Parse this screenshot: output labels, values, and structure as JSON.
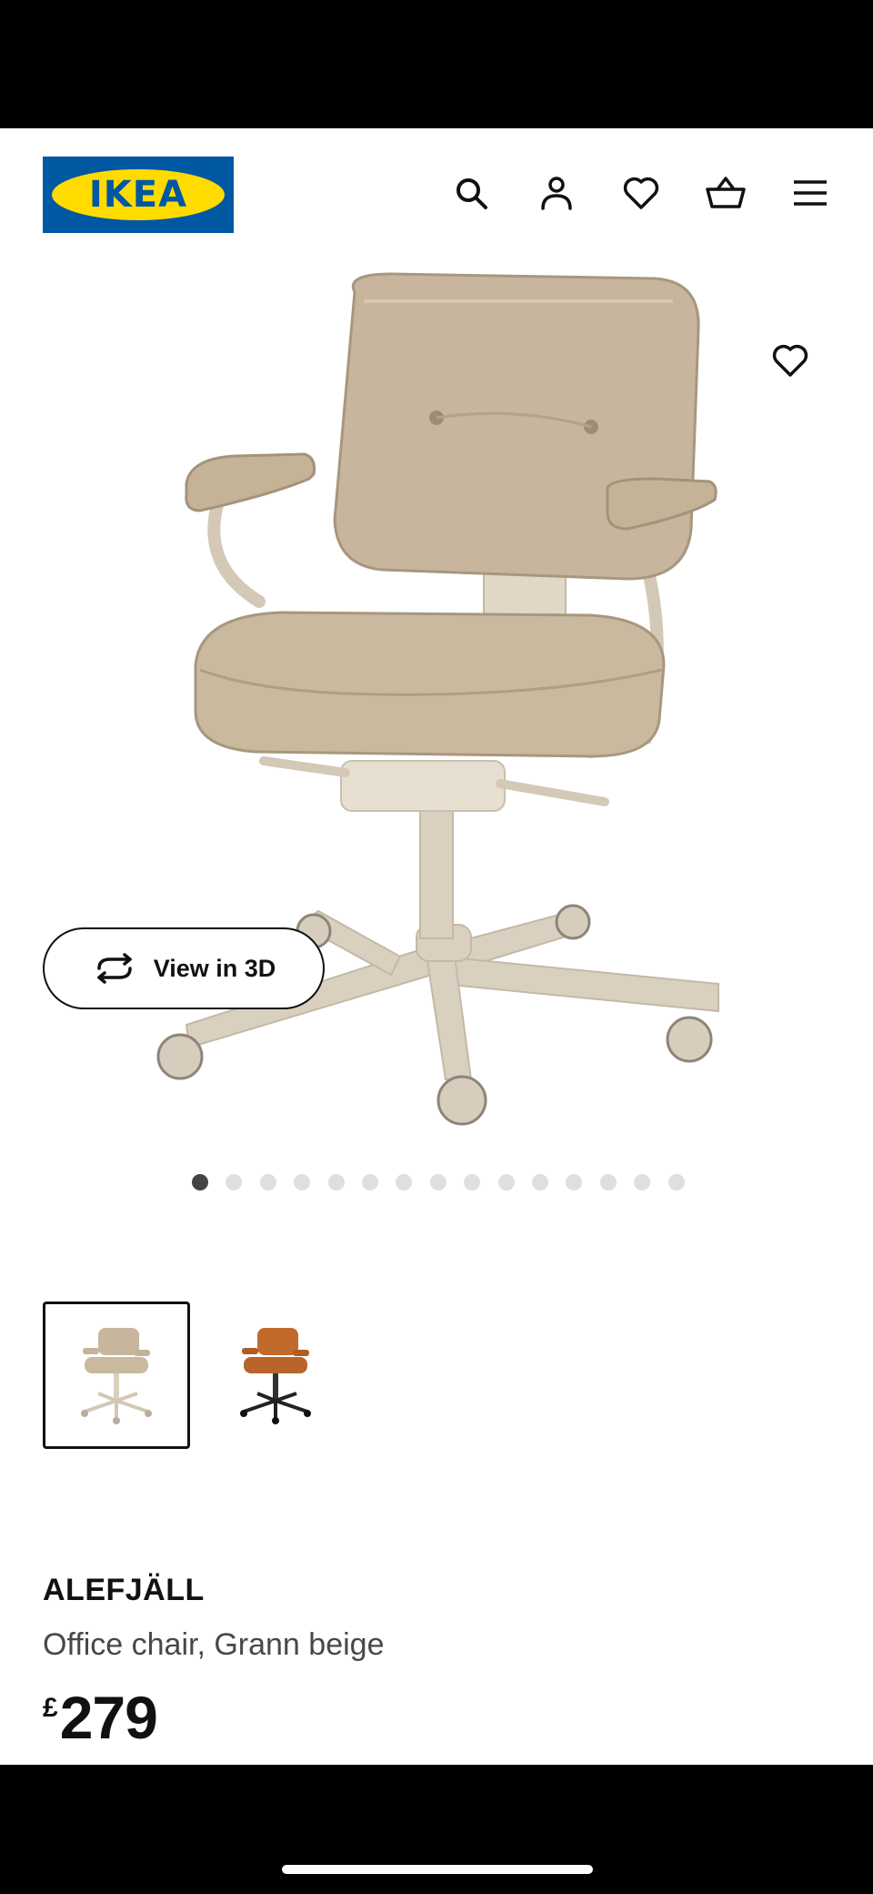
{
  "header": {
    "logo_text": "IKEA",
    "icons": [
      "search-icon",
      "account-icon",
      "heart-icon",
      "basket-icon",
      "menu-icon"
    ]
  },
  "gallery": {
    "view3d_label": "View in 3D",
    "total_images": 15,
    "active_index": 0,
    "thumbnails": [
      {
        "variant": "beige",
        "selected": true
      },
      {
        "variant": "golden-brown",
        "selected": false
      }
    ]
  },
  "product": {
    "name": "ALEFJÄLL",
    "description": "Office chair, Grann beige",
    "currency": "£",
    "price": "279"
  },
  "colors": {
    "ikea_blue": "#0058a3",
    "ikea_yellow": "#ffdb00",
    "chair_beige": "#c7b69d",
    "chair_brown": "#c06b2c"
  }
}
